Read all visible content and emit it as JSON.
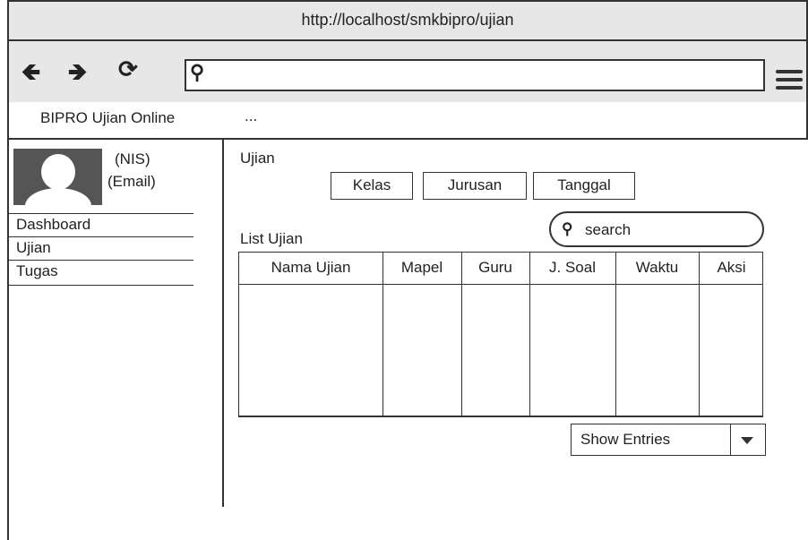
{
  "browser": {
    "url_title": "http://localhost/smkbipro/ujian",
    "address_value": "",
    "icons": [
      "back-arrow-icon",
      "forward-arrow-icon",
      "reload-icon",
      "search-icon",
      "hamburger-menu-icon"
    ]
  },
  "app": {
    "title": "BIPRO Ujian Online",
    "extra": "..."
  },
  "user": {
    "nis": "(NIS)",
    "email": "(Email)"
  },
  "sidebar": {
    "items": [
      {
        "label": "Dashboard"
      },
      {
        "label": "Ujian"
      },
      {
        "label": "Tugas"
      }
    ]
  },
  "main": {
    "section_title": "Ujian",
    "filters": [
      {
        "label": "Kelas"
      },
      {
        "label": "Jurusan"
      },
      {
        "label": "Tanggal"
      }
    ],
    "list_title": "List Ujian",
    "search_placeholder": "search",
    "table": {
      "columns": [
        "Nama Ujian",
        "Mapel",
        "Guru",
        "J. Soal",
        "Waktu",
        "Aksi"
      ],
      "rows": []
    },
    "show_entries_label": "Show Entries"
  }
}
